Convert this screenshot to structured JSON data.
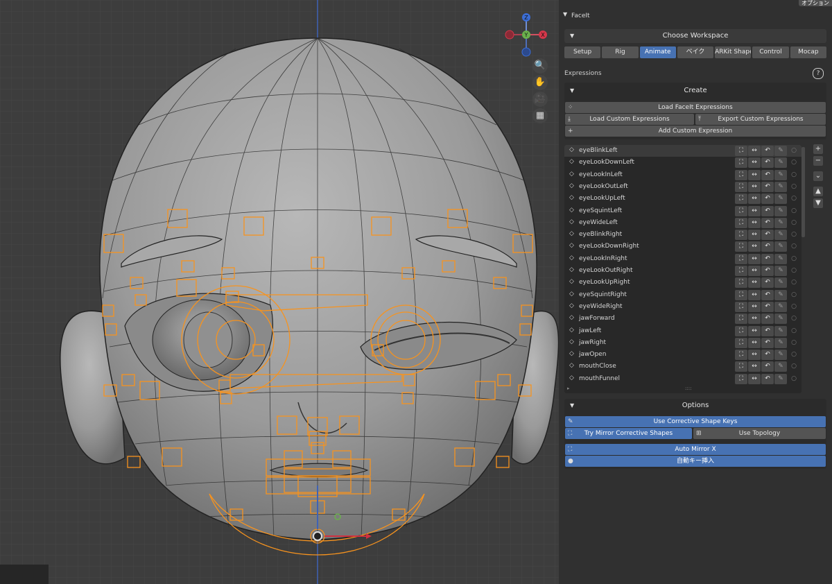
{
  "panel": {
    "corner_label": "オプション",
    "title": "FaceIt",
    "workspace_header": "Choose Workspace",
    "tabs": [
      {
        "label": "Setup",
        "active": false
      },
      {
        "label": "Rig",
        "active": false
      },
      {
        "label": "Animate",
        "active": true
      },
      {
        "label": "ベイク",
        "active": false
      },
      {
        "label": "ARKit Shapes",
        "active": false
      },
      {
        "label": "Control",
        "active": false
      },
      {
        "label": "Mocap",
        "active": false
      }
    ],
    "expressions_label": "Expressions",
    "help_icon": "question-icon",
    "create_header": "Create",
    "load_faceit_label": "Load FaceIt Expressions",
    "load_custom_label": "Load Custom Expressions",
    "export_custom_label": "Export Custom Expressions",
    "add_custom_label": "Add Custom Expression",
    "options_header": "Options",
    "use_corrective_label": "Use Corrective Shape Keys",
    "try_mirror_label": "Try Mirror Corrective Shapes",
    "use_topology_label": "Use Topology",
    "auto_mirror_label": "Auto Mirror X",
    "auto_key_label": "自動キー挿入",
    "list_grip": "::::",
    "list_expand": "▸"
  },
  "expressions": [
    "eyeBlinkLeft",
    "eyeLookDownLeft",
    "eyeLookInLeft",
    "eyeLookOutLeft",
    "eyeLookUpLeft",
    "eyeSquintLeft",
    "eyeWideLeft",
    "eyeBlinkRight",
    "eyeLookDownRight",
    "eyeLookInRight",
    "eyeLookOutRight",
    "eyeLookUpRight",
    "eyeSquintRight",
    "eyeWideRight",
    "jawForward",
    "jawLeft",
    "jawRight",
    "jawOpen",
    "mouthClose",
    "mouthFunnel"
  ],
  "selected_expression": 0,
  "gizmo": {
    "z": "Z",
    "y": "Y",
    "x": "X"
  },
  "colors": {
    "accent": "#4772b3",
    "rig": "#f7931e",
    "panel": "#303030"
  }
}
